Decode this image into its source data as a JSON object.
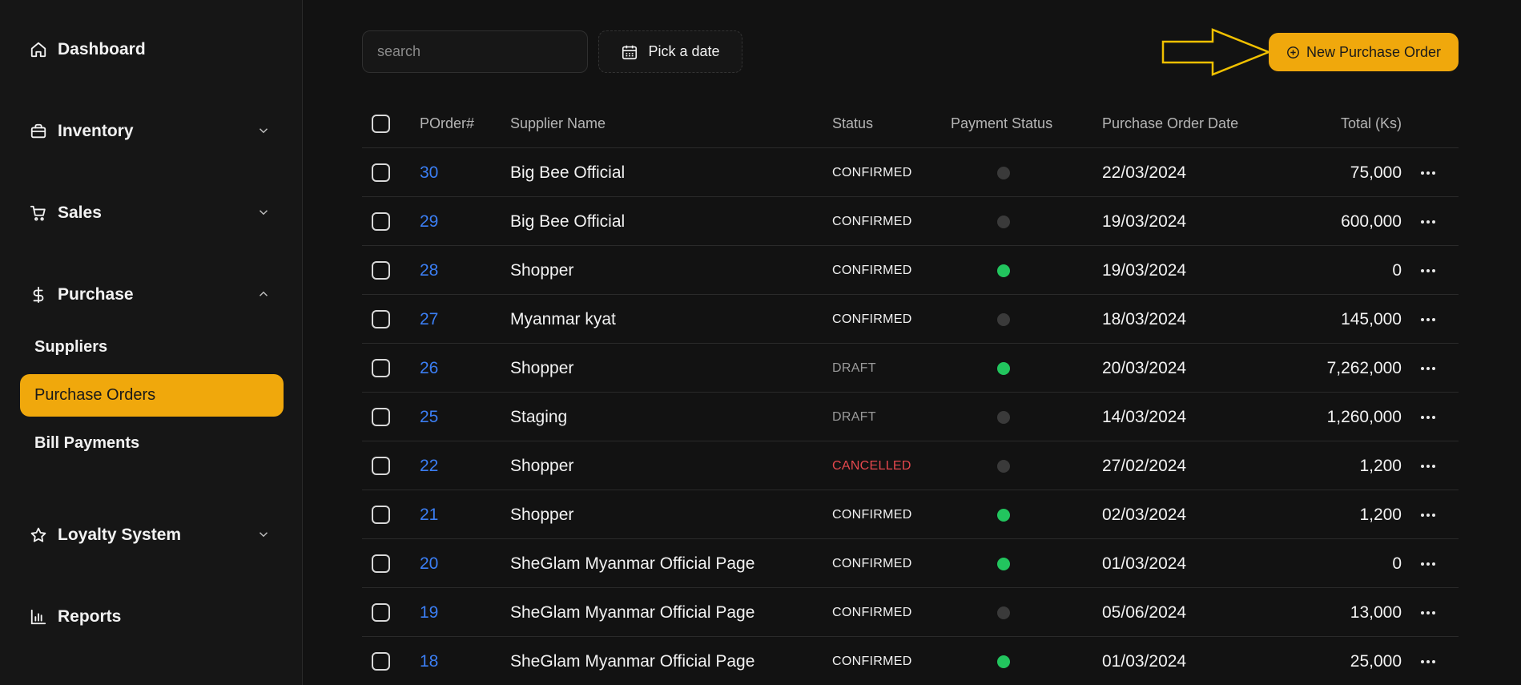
{
  "sidebar": {
    "items": [
      {
        "label": "Dashboard",
        "icon": "home-icon"
      },
      {
        "label": "Inventory",
        "icon": "box-icon"
      },
      {
        "label": "Sales",
        "icon": "cart-icon"
      },
      {
        "label": "Purchase",
        "icon": "dollar-icon"
      },
      {
        "label": "Loyalty System",
        "icon": "star-icon"
      },
      {
        "label": "Reports",
        "icon": "bar-chart-icon"
      }
    ],
    "purchase_subitems": [
      "Suppliers",
      "Purchase Orders",
      "Bill Payments"
    ],
    "active_subitem": "Purchase Orders"
  },
  "toolbar": {
    "search_placeholder": "search",
    "date_label": "Pick a date",
    "new_label": "New Purchase Order"
  },
  "table": {
    "headers": [
      "POrder#",
      "Supplier Name",
      "Status",
      "Payment Status",
      "Purchase Order Date",
      "Total (Ks)"
    ],
    "rows": [
      {
        "id": "30",
        "supplier": "Big Bee Official",
        "status": "CONFIRMED",
        "paid": false,
        "date": "22/03/2024",
        "total": "75,000"
      },
      {
        "id": "29",
        "supplier": "Big Bee Official",
        "status": "CONFIRMED",
        "paid": false,
        "date": "19/03/2024",
        "total": "600,000"
      },
      {
        "id": "28",
        "supplier": "Shopper",
        "status": "CONFIRMED",
        "paid": true,
        "date": "19/03/2024",
        "total": "0"
      },
      {
        "id": "27",
        "supplier": "Myanmar kyat",
        "status": "CONFIRMED",
        "paid": false,
        "date": "18/03/2024",
        "total": "145,000"
      },
      {
        "id": "26",
        "supplier": "Shopper",
        "status": "DRAFT",
        "paid": true,
        "date": "20/03/2024",
        "total": "7,262,000"
      },
      {
        "id": "25",
        "supplier": "Staging",
        "status": "DRAFT",
        "paid": false,
        "date": "14/03/2024",
        "total": "1,260,000"
      },
      {
        "id": "22",
        "supplier": "Shopper",
        "status": "CANCELLED",
        "paid": false,
        "date": "27/02/2024",
        "total": "1,200"
      },
      {
        "id": "21",
        "supplier": "Shopper",
        "status": "CONFIRMED",
        "paid": true,
        "date": "02/03/2024",
        "total": "1,200"
      },
      {
        "id": "20",
        "supplier": "SheGlam Myanmar Official Page",
        "status": "CONFIRMED",
        "paid": true,
        "date": "01/03/2024",
        "total": "0"
      },
      {
        "id": "19",
        "supplier": "SheGlam Myanmar Official Page",
        "status": "CONFIRMED",
        "paid": false,
        "date": "05/06/2024",
        "total": "13,000"
      },
      {
        "id": "18",
        "supplier": "SheGlam Myanmar Official Page",
        "status": "CONFIRMED",
        "paid": true,
        "date": "01/03/2024",
        "total": "25,000"
      }
    ]
  },
  "colors": {
    "accent": "#f0a80c",
    "link": "#3b7ef3",
    "confirmed": "#f2f2f2",
    "draft": "#9a9a9a",
    "cancelled": "#e5484d",
    "paid": "#22c55e",
    "unpaid": "#3a3a3a"
  }
}
